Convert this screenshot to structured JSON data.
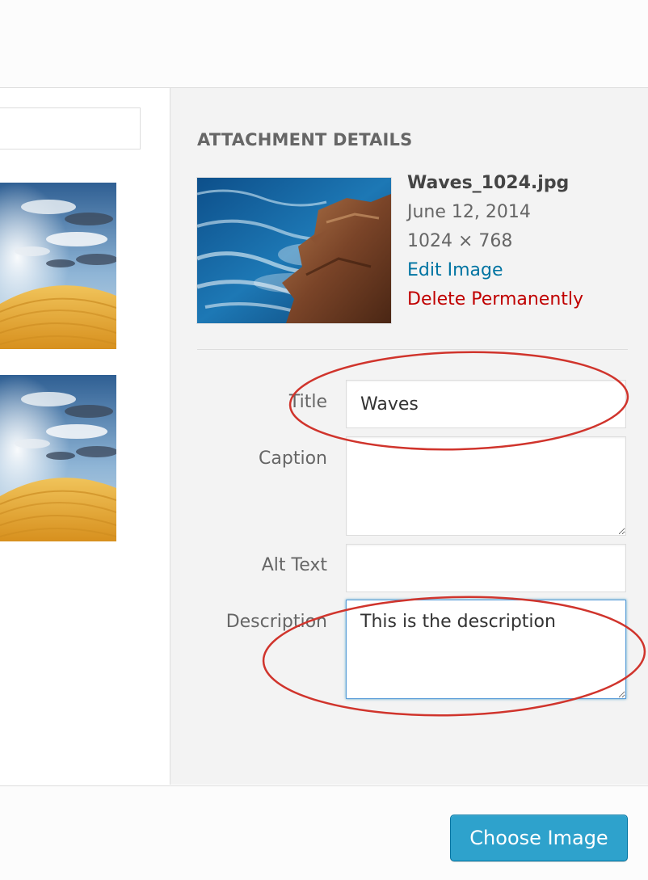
{
  "media_browser": {
    "thumbnails": [
      {
        "kind": "desert-dune-photo"
      },
      {
        "kind": "desert-dune-photo"
      }
    ]
  },
  "details": {
    "heading": "ATTACHMENT DETAILS",
    "filename": "Waves_1024.jpg",
    "uploaded": "June 12, 2014",
    "dimensions": "1024 × 768",
    "edit_link": "Edit Image",
    "delete_link": "Delete Permanently"
  },
  "fields": {
    "title": {
      "label": "Title",
      "value": "Waves"
    },
    "caption": {
      "label": "Caption",
      "value": ""
    },
    "alt": {
      "label": "Alt Text",
      "value": ""
    },
    "description": {
      "label": "Description",
      "value": "This is the description"
    }
  },
  "footer": {
    "choose_label": "Choose Image"
  },
  "colors": {
    "link": "#0074a2",
    "delete": "#c00000",
    "button": "#2ea2cc",
    "annotation": "#d0342c"
  }
}
